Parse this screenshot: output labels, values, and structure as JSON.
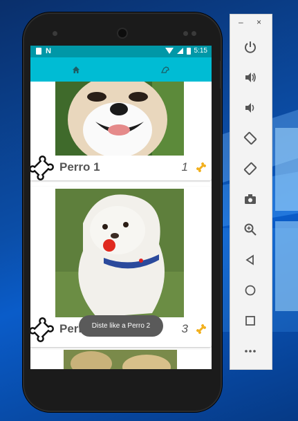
{
  "status_bar": {
    "time": "5:15",
    "icons": [
      "sd-card-icon",
      "n-notification-icon",
      "wifi-icon",
      "signal-icon",
      "battery-icon"
    ]
  },
  "toolbar": {
    "tabs": [
      {
        "icon": "home-icon"
      },
      {
        "icon": "dog-paw-icon"
      }
    ],
    "color": "#00bcd4",
    "status_color": "#0097a7"
  },
  "pets": [
    {
      "name": "Perro 1",
      "likes": "1"
    },
    {
      "name": "Perro 2",
      "likes": "3"
    }
  ],
  "toast": {
    "text": "Diste like a Perro 2"
  },
  "emulator": {
    "minimize": "–",
    "close": "×",
    "buttons": [
      "power-icon",
      "volume-up-icon",
      "volume-down-icon",
      "rotate-left-icon",
      "rotate-right-icon",
      "camera-icon",
      "zoom-icon",
      "back-icon",
      "home-circle-icon",
      "overview-icon",
      "more-icon"
    ]
  }
}
